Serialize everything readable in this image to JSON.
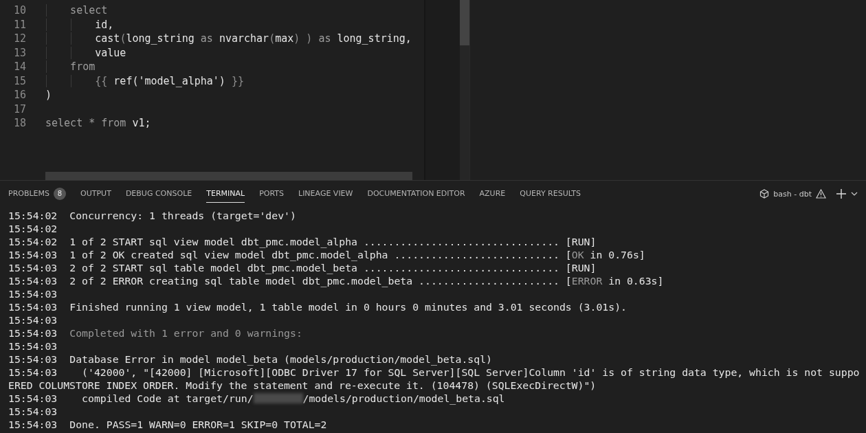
{
  "editor": {
    "lines": [
      {
        "number": "10",
        "tokens": [
          {
            "text": "    select",
            "kind": "keyword"
          }
        ]
      },
      {
        "number": "11",
        "tokens": [
          {
            "text": "        id,",
            "kind": "ident"
          }
        ]
      },
      {
        "number": "12",
        "tokens": [
          {
            "text": "        cast",
            "kind": "ident"
          },
          {
            "text": "(",
            "kind": "punct"
          },
          {
            "text": "long_string ",
            "kind": "ident"
          },
          {
            "text": "as ",
            "kind": "keyword"
          },
          {
            "text": "nvarchar",
            "kind": "ident"
          },
          {
            "text": "(",
            "kind": "punct"
          },
          {
            "text": "max",
            "kind": "ident"
          },
          {
            "text": ") ) ",
            "kind": "punct"
          },
          {
            "text": "as ",
            "kind": "keyword"
          },
          {
            "text": "long_string,",
            "kind": "ident"
          }
        ]
      },
      {
        "number": "13",
        "tokens": [
          {
            "text": "        value",
            "kind": "ident"
          }
        ]
      },
      {
        "number": "14",
        "tokens": [
          {
            "text": "    from",
            "kind": "keyword"
          }
        ]
      },
      {
        "number": "15",
        "tokens": [
          {
            "text": "        {{ ",
            "kind": "punct"
          },
          {
            "text": "ref('model_alpha') ",
            "kind": "ident"
          },
          {
            "text": "}}",
            "kind": "punct"
          }
        ]
      },
      {
        "number": "16",
        "tokens": [
          {
            "text": ")",
            "kind": "ident"
          }
        ]
      },
      {
        "number": "17"
      },
      {
        "number": "18",
        "tokens": [
          {
            "text": "select * from ",
            "kind": "keyword"
          },
          {
            "text": "v1;",
            "kind": "ident"
          }
        ]
      }
    ]
  },
  "panel": {
    "tabs": [
      {
        "label": "PROBLEMS",
        "badge": "8",
        "selected": false
      },
      {
        "label": "OUTPUT",
        "selected": false
      },
      {
        "label": "DEBUG CONSOLE",
        "selected": false
      },
      {
        "label": "TERMINAL",
        "selected": true
      },
      {
        "label": "PORTS",
        "selected": false
      },
      {
        "label": "LINEAGE VIEW",
        "selected": false
      },
      {
        "label": "DOCUMENTATION EDITOR",
        "selected": false
      },
      {
        "label": "AZURE",
        "selected": false
      },
      {
        "label": "QUERY RESULTS",
        "selected": false
      }
    ],
    "terminal_name": "bash - dbt"
  },
  "terminal": {
    "lines": [
      {
        "time": "15:54:02",
        "segments": [
          {
            "text": "Concurrency: 1 threads (target='dev')",
            "dim": false
          }
        ]
      },
      {
        "time": "15:54:02"
      },
      {
        "time": "15:54:02",
        "segments": [
          {
            "text": "1 of 2 START sql view model dbt_pmc.model_alpha ................................ [RUN]",
            "dim": false
          }
        ]
      },
      {
        "time": "15:54:03",
        "segments": [
          {
            "text": "1 of 2 OK created sql view model dbt_pmc.model_alpha ........................... [",
            "dim": false
          },
          {
            "text": "OK",
            "dim": true
          },
          {
            "text": " in 0.76s]",
            "dim": false
          }
        ]
      },
      {
        "time": "15:54:03",
        "segments": [
          {
            "text": "2 of 2 START sql table model dbt_pmc.model_beta ................................ [RUN]",
            "dim": false
          }
        ]
      },
      {
        "time": "15:54:03",
        "segments": [
          {
            "text": "2 of 2 ERROR creating sql table model dbt_pmc.model_beta ....................... [",
            "dim": false
          },
          {
            "text": "ERROR",
            "dim": true
          },
          {
            "text": " in 0.63s]",
            "dim": false
          }
        ]
      },
      {
        "time": "15:54:03"
      },
      {
        "time": "15:54:03",
        "segments": [
          {
            "text": "Finished running 1 view model, 1 table model in 0 hours 0 minutes and 3.01 seconds (3.01s).",
            "dim": false
          }
        ]
      },
      {
        "time": "15:54:03"
      },
      {
        "time": "15:54:03",
        "segments": [
          {
            "text": "Completed with 1 error and 0 warnings:",
            "dim": true
          }
        ]
      },
      {
        "time": "15:54:03"
      },
      {
        "time": "15:54:03",
        "segments": [
          {
            "text": "Database Error in model model_beta (models/production/model_beta.sql)",
            "dim": false
          }
        ]
      },
      {
        "time": "15:54:03",
        "segments": [
          {
            "text": "  ('42000', \"[42000] [Microsoft][ODBC Driver 17 for SQL Server][SQL Server]Column 'id' is of string data type, which is not suppo",
            "dim": false
          }
        ]
      },
      {
        "segments": [
          {
            "text": "ERED COLUMSTORE INDEX ORDER. Modify the statement and re-execute it. (104478) (SQLExecDirectW)\")",
            "dim": false
          }
        ]
      },
      {
        "time": "15:54:03",
        "segments": [
          {
            "text": "  compiled Code at target/run/",
            "dim": false
          }
        ],
        "redacted": true,
        "after": [
          {
            "text": "/models/production/model_beta.sql",
            "dim": false
          }
        ]
      },
      {
        "time": "15:54:03"
      },
      {
        "time": "15:54:03",
        "segments": [
          {
            "text": "Done. PASS=1 WARN=0 ERROR=1 SKIP=0 TOTAL=2",
            "dim": false
          }
        ]
      }
    ]
  }
}
